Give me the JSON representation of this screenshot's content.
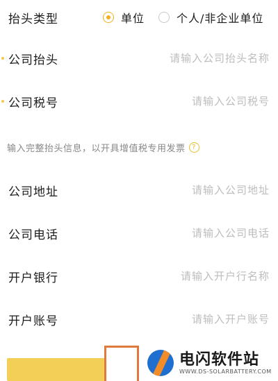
{
  "title_type": {
    "label": "抬头类型",
    "options": [
      "单位",
      "个人/非企业单位"
    ],
    "selected": "单位"
  },
  "company_header": {
    "label": "公司抬头",
    "placeholder": "请输入公司抬头名称",
    "required": true
  },
  "company_tax": {
    "label": "公司税号",
    "placeholder": "请输入公司税号",
    "required": true
  },
  "hint": {
    "text": "输入完整抬头信息，以开具增值税专用发票",
    "icon": "?"
  },
  "company_address": {
    "label": "公司地址",
    "placeholder": "请输入公司地址"
  },
  "company_phone": {
    "label": "公司电话",
    "placeholder": "请输入公司电话"
  },
  "bank": {
    "label": "开户银行",
    "placeholder": "请输入开户行名称"
  },
  "account": {
    "label": "开户账号",
    "placeholder": "请输入开户账号"
  },
  "watermark": {
    "title": "电闪软件站",
    "subtitle": "WWW.DS-SOLARBATTERY.COM"
  },
  "colors": {
    "accent": "#f2b01e",
    "button": "#f3cf57",
    "highlight": "#e07a3c"
  }
}
